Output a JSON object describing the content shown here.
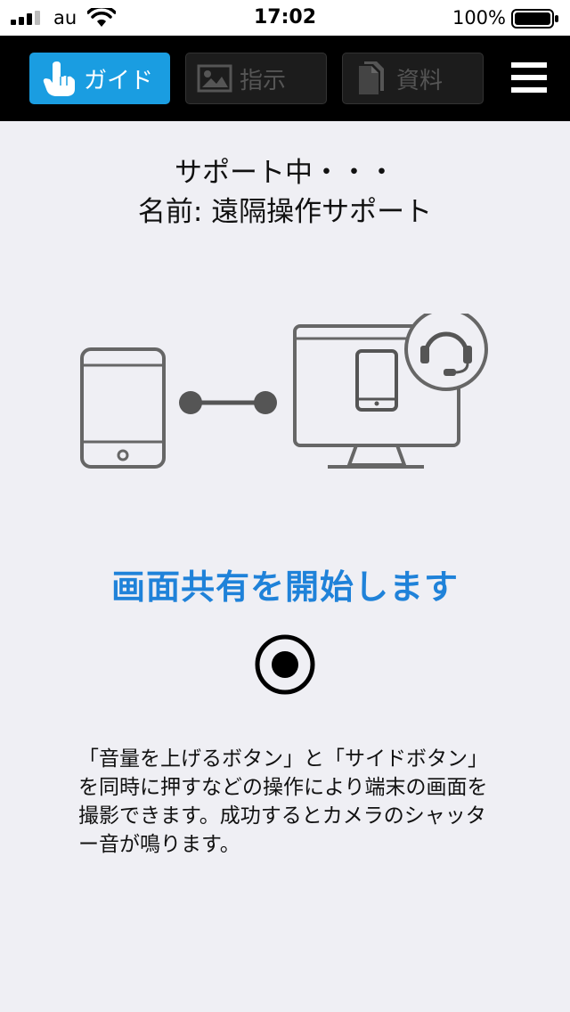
{
  "status_bar": {
    "carrier": "au",
    "time": "17:02",
    "battery": "100%"
  },
  "toolbar": {
    "tabs": [
      {
        "label": "ガイド",
        "icon": "hand-pointer-icon",
        "active": true
      },
      {
        "label": "指示",
        "icon": "image-icon",
        "active": false
      },
      {
        "label": "資料",
        "icon": "document-icon",
        "active": false
      }
    ],
    "menu_icon": "hamburger-menu-icon"
  },
  "session": {
    "status": "サポート中・・・",
    "name_line": "名前: 遠隔操作サポート"
  },
  "main": {
    "heading": "画面共有を開始します",
    "record_icon": "record-icon",
    "instructions": "「音量を上げるボタン」と「サイドボタン」を同時に押すなどの操作により端末の画面を撮影できます。成功するとカメラのシャッター音が鳴ります。"
  },
  "colors": {
    "accent": "#1a9de1",
    "heading": "#1f82d9",
    "toolbar_bg": "#000000",
    "page_bg": "#efeff4"
  }
}
